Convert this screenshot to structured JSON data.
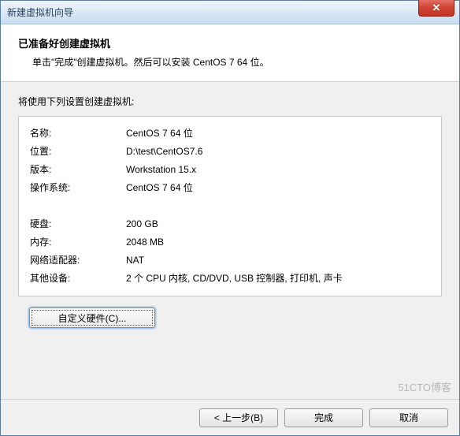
{
  "window": {
    "title": "新建虚拟机向导"
  },
  "header": {
    "title": "已准备好创建虚拟机",
    "subtitle": "单击\"完成\"创建虚拟机。然后可以安装 CentOS 7 64 位。"
  },
  "intro": "将使用下列设置创建虚拟机:",
  "summary": {
    "name_label": "名称:",
    "name_value": "CentOS 7 64 位",
    "location_label": "位置:",
    "location_value": "D:\\test\\CentOS7.6",
    "version_label": "版本:",
    "version_value": "Workstation 15.x",
    "os_label": "操作系统:",
    "os_value": "CentOS 7 64 位",
    "disk_label": "硬盘:",
    "disk_value": "200 GB",
    "memory_label": "内存:",
    "memory_value": "2048 MB",
    "network_label": "网络适配器:",
    "network_value": "NAT",
    "other_label": "其他设备:",
    "other_value": "2 个 CPU 内核, CD/DVD, USB 控制器, 打印机, 声卡"
  },
  "buttons": {
    "customize": "自定义硬件(C)...",
    "back": "< 上一步(B)",
    "finish": "完成",
    "cancel": "取消",
    "close_glyph": "✕"
  },
  "watermark": "51CTO博客"
}
